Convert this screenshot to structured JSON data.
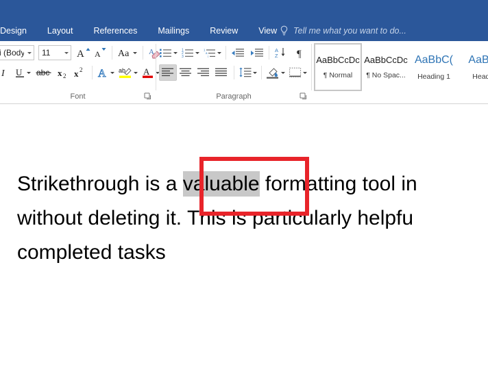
{
  "colors": {
    "ribbon_blue": "#2b579a",
    "accent_red": "#e8242a",
    "selection_gray": "#c8c8c8",
    "heading_blue": "#2e74b5"
  },
  "tabbar": {
    "tabs": [
      {
        "label": "Design"
      },
      {
        "label": "Layout"
      },
      {
        "label": "References"
      },
      {
        "label": "Mailings"
      },
      {
        "label": "Review"
      },
      {
        "label": "View"
      }
    ],
    "tellme": {
      "icon": "lightbulb-icon",
      "placeholder": "Tell me what you want to do..."
    }
  },
  "ribbon": {
    "groups": [
      {
        "name": "Font",
        "label": "Font",
        "dialog_launcher": "dialog-launcher-icon",
        "font_name": {
          "value": "i (Body)",
          "icon": "chevron-down-icon"
        },
        "font_size": {
          "value": "11",
          "icon": "chevron-down-icon"
        },
        "row1_buttons": [
          {
            "name": "grow-font-button",
            "icon": "grow-font-icon",
            "label": "A"
          },
          {
            "name": "shrink-font-button",
            "icon": "shrink-font-icon",
            "label": "A"
          },
          {
            "name": "change-case-button",
            "icon": "change-case-icon",
            "label": "Aa"
          },
          {
            "name": "clear-formatting-button",
            "icon": "clear-formatting-icon",
            "label": ""
          }
        ],
        "row2_buttons": [
          {
            "name": "italic-button",
            "icon": "italic-icon",
            "label": "I"
          },
          {
            "name": "underline-button",
            "icon": "underline-icon",
            "label": "U"
          },
          {
            "name": "strikethrough-button",
            "icon": "strikethrough-icon",
            "label": "abc"
          },
          {
            "name": "subscript-button",
            "icon": "subscript-icon",
            "label": "x"
          },
          {
            "name": "superscript-button",
            "icon": "superscript-icon",
            "label": "x"
          },
          {
            "name": "text-effects-button",
            "icon": "text-effects-icon",
            "label": "A"
          },
          {
            "name": "text-highlight-button",
            "icon": "text-highlight-icon",
            "label": "ab"
          },
          {
            "name": "font-color-button",
            "icon": "font-color-icon",
            "label": "A"
          }
        ]
      },
      {
        "name": "Paragraph",
        "label": "Paragraph",
        "dialog_launcher": "dialog-launcher-icon",
        "row1_buttons": [
          {
            "name": "bullets-button",
            "icon": "bullet-list-icon"
          },
          {
            "name": "numbering-button",
            "icon": "numbered-list-icon"
          },
          {
            "name": "multilevel-list-button",
            "icon": "multilevel-list-icon"
          },
          {
            "name": "decrease-indent-button",
            "icon": "decrease-indent-icon"
          },
          {
            "name": "increase-indent-button",
            "icon": "increase-indent-icon"
          },
          {
            "name": "sort-button",
            "icon": "sort-az-icon"
          },
          {
            "name": "show-formatting-marks-button",
            "icon": "pilcrow-icon"
          }
        ],
        "row2_buttons": [
          {
            "name": "align-left-button",
            "icon": "align-left-icon",
            "selected": true
          },
          {
            "name": "align-center-button",
            "icon": "align-center-icon"
          },
          {
            "name": "align-right-button",
            "icon": "align-right-icon"
          },
          {
            "name": "justify-button",
            "icon": "justify-icon"
          },
          {
            "name": "line-spacing-button",
            "icon": "line-spacing-icon"
          },
          {
            "name": "shading-button",
            "icon": "shading-icon"
          },
          {
            "name": "borders-button",
            "icon": "borders-icon"
          }
        ]
      },
      {
        "name": "Styles",
        "label": "",
        "items": [
          {
            "preview": "AaBbCcDc",
            "name": "¶ Normal",
            "selected": true,
            "heading": false
          },
          {
            "preview": "AaBbCcDc",
            "name": "¶ No Spac...",
            "selected": false,
            "heading": false
          },
          {
            "preview": "AaBbC(",
            "name": "Heading 1",
            "selected": false,
            "heading": true
          },
          {
            "preview": "AaBb",
            "name": "Headi",
            "selected": false,
            "heading": true
          }
        ]
      }
    ]
  },
  "document": {
    "lines": [
      {
        "before": "Strikethrough is a ",
        "selected": "valuable",
        "after": " formatting tool in"
      },
      {
        "text": "without deleting it. This is particularly helpfu"
      },
      {
        "text": "completed tasks"
      }
    ],
    "annotation": {
      "name": "red-highlight-rectangle",
      "shape": "rectangle",
      "color": "#e8242a"
    }
  }
}
